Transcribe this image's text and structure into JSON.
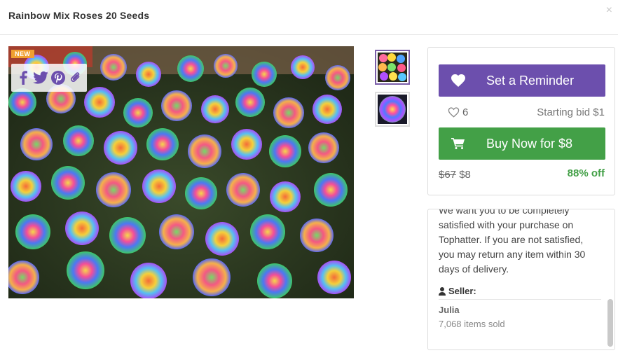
{
  "header": {
    "title": "Rainbow Mix Roses 20 Seeds",
    "close_label": "×"
  },
  "product_image": {
    "badge": "NEW"
  },
  "share": {
    "icons": [
      "facebook-icon",
      "twitter-icon",
      "pinterest-icon",
      "link-icon"
    ]
  },
  "thumbnails": {
    "count": 2,
    "selected_index": 0
  },
  "buy_panel": {
    "reminder_label": "Set a Reminder",
    "likes_count": "6",
    "starting_bid": "Starting bid $1",
    "buy_now_label": "Buy Now for $8",
    "original_price": "$67",
    "current_price": "$8",
    "discount": "88% off"
  },
  "info_panel": {
    "guarantee_text": "We want you to be completely satisfied with your purchase on Tophatter. If you are not satisfied, you may return any item within 30 days of delivery.",
    "seller_label": "Seller:",
    "seller_name": "Julia",
    "items_sold": "7,068 items sold"
  },
  "colors": {
    "reminder_purple": "#6c4fad",
    "buy_green": "#43a047",
    "badge_orange": "#f0a030"
  }
}
